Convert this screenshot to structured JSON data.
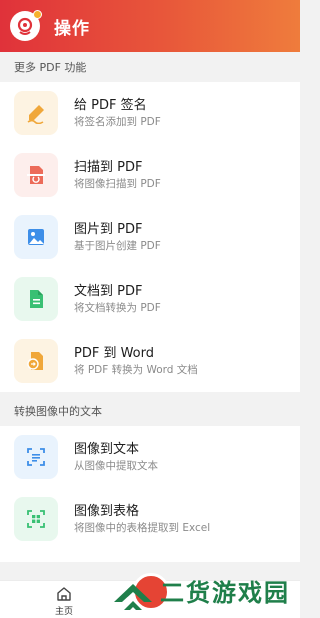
{
  "header": {
    "title": "操作"
  },
  "sections": [
    {
      "title": "更多 PDF 功能",
      "items": [
        {
          "title": "给 PDF 签名",
          "subtitle": "将签名添加到 PDF",
          "icon": "signature-pen-icon",
          "tile_color": "#fdf3e2",
          "icon_color": "#f0a73a"
        },
        {
          "title": "扫描到 PDF",
          "subtitle": "将图像扫描到 PDF",
          "icon": "scan-document-icon",
          "tile_color": "#fdeeec",
          "icon_color": "#ec6b59"
        },
        {
          "title": "图片到 PDF",
          "subtitle": "基于图片创建 PDF",
          "icon": "image-icon",
          "tile_color": "#e9f3fd",
          "icon_color": "#3d8ee8"
        },
        {
          "title": "文档到 PDF",
          "subtitle": "将文档转换为 PDF",
          "icon": "document-icon",
          "tile_color": "#e8f8ee",
          "icon_color": "#39c073"
        },
        {
          "title": "PDF 到 Word",
          "subtitle": "将 PDF 转换为 Word 文档",
          "icon": "pdf-convert-icon",
          "tile_color": "#fdf3e2",
          "icon_color": "#f0a73a"
        }
      ]
    },
    {
      "title": "转换图像中的文本",
      "items": [
        {
          "title": "图像到文本",
          "subtitle": "从图像中提取文本",
          "icon": "text-recognition-icon",
          "tile_color": "#e9f3fd",
          "icon_color": "#3d8ee8"
        },
        {
          "title": "图像到表格",
          "subtitle": "将图像中的表格提取到 Excel",
          "icon": "table-scan-icon",
          "tile_color": "#e8f8ee",
          "icon_color": "#39c073"
        }
      ]
    }
  ],
  "bottom_nav": {
    "home_label": "主页"
  },
  "watermark": {
    "text": "二货游戏园"
  }
}
